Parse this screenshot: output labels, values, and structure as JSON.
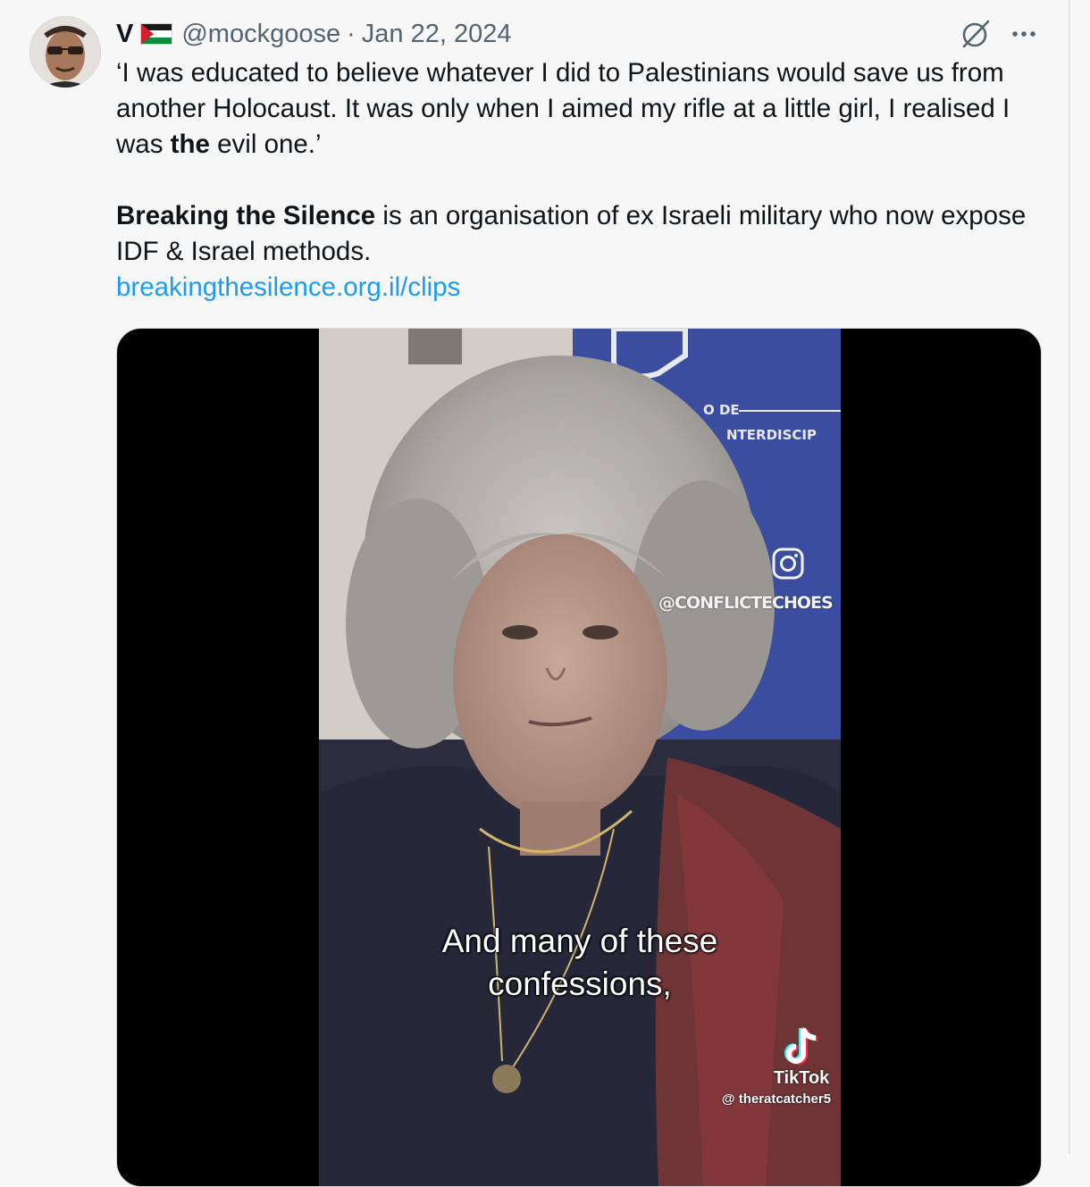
{
  "tweet": {
    "display_name": "V",
    "flag_icon": "palestine-flag-icon",
    "handle": "@mockgoose",
    "separator": "·",
    "date": "Jan 22, 2024",
    "grok_icon": "grok-icon",
    "more_icon": "more-options-icon",
    "text": {
      "para1_part1": "‘I was educated to believe whatever I did to Palestinians would save us from another Holocaust. It was only when I aimed my rifle at a little girl, I realised I was ",
      "para1_bold": "the",
      "para1_part2": " evil one.’",
      "para2_bold": "Breaking the Silence",
      "para2_rest": " is an organisation of ex Israeli military who now expose IDF & Israel methods.",
      "link": "breakingthesilence.org.il/clips"
    }
  },
  "video": {
    "watermark": "@CONFLICTECHOES",
    "instagram_icon": "instagram-icon",
    "caption_line1": "And many of these",
    "caption_line2": "confessions,",
    "tiktok_icon": "tiktok-icon",
    "tiktok_label": "TikTok",
    "tiktok_handle": "@ theratcatcher5",
    "background_sign": {
      "line1": "O DE",
      "line2": "NTERDISCIP"
    }
  },
  "colors": {
    "background": "#f7f7f7",
    "text": "#0f1419",
    "secondary": "#536471",
    "link": "#1d9bf0",
    "media_bg": "#000000"
  }
}
